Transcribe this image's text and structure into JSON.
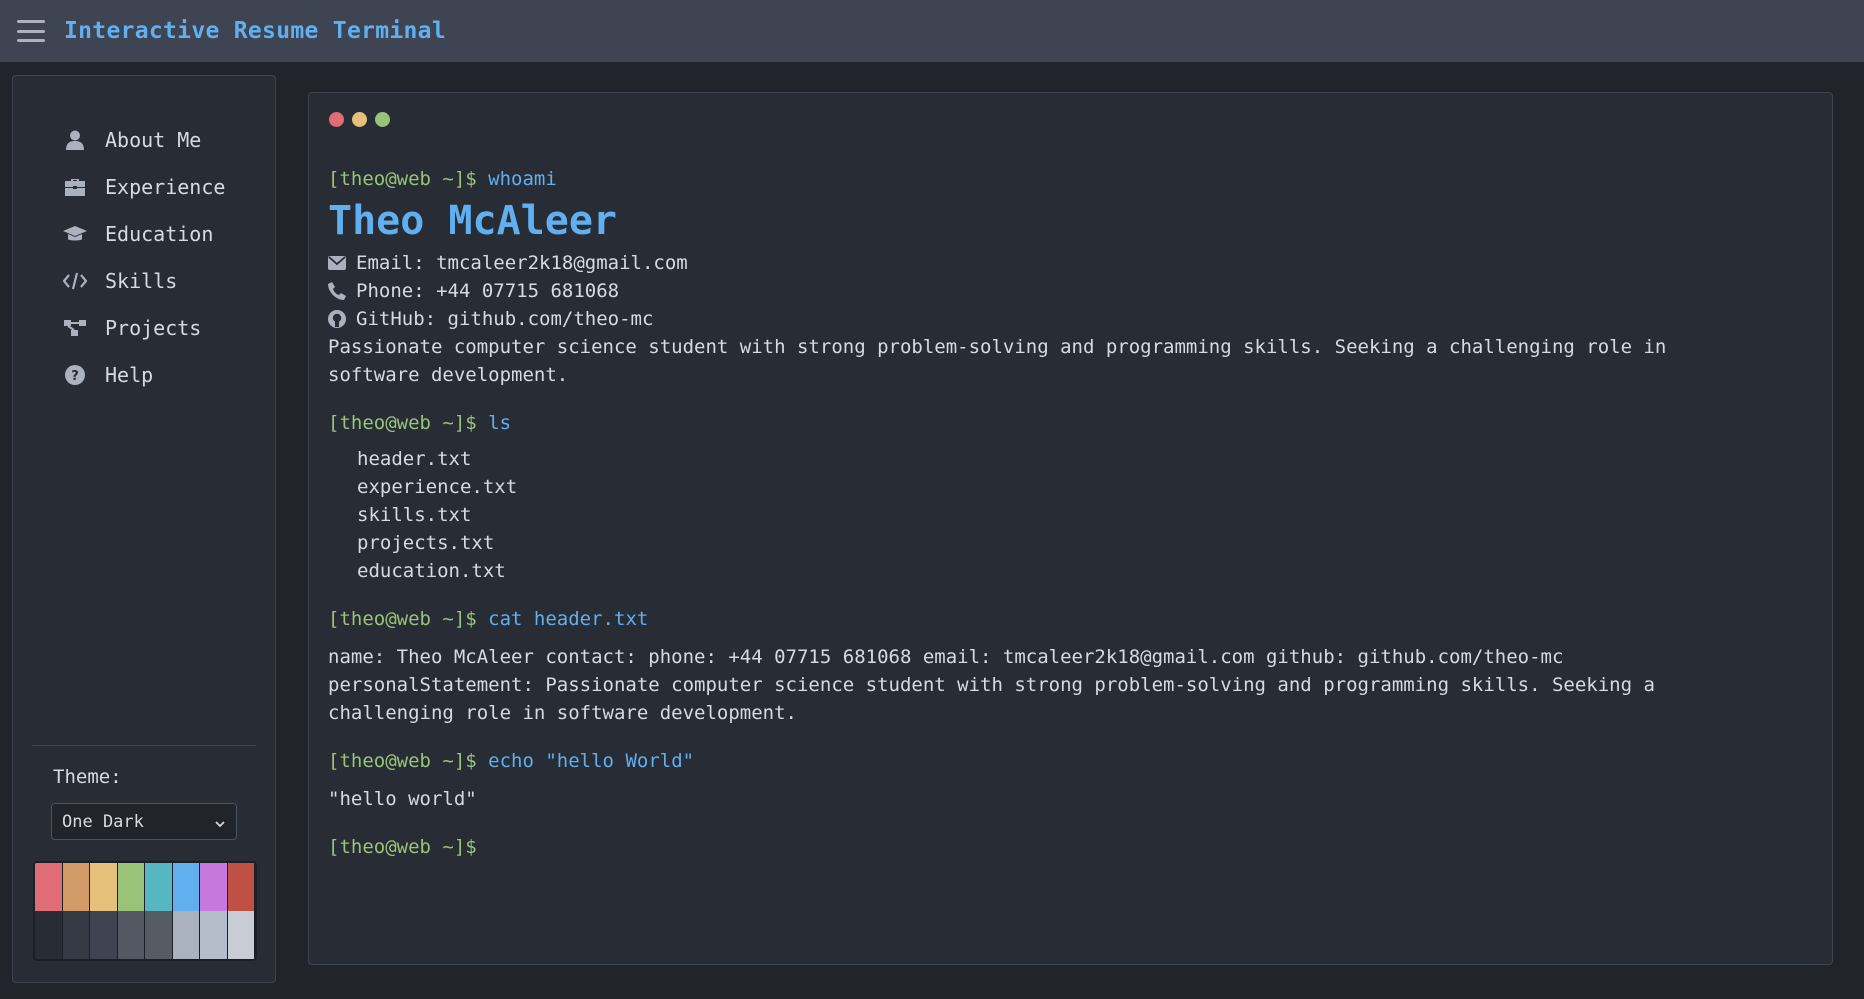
{
  "app": {
    "title": "Interactive Resume Terminal"
  },
  "sidebar": {
    "items": [
      {
        "label": "About Me",
        "icon": "user-icon"
      },
      {
        "label": "Experience",
        "icon": "briefcase-icon"
      },
      {
        "label": "Education",
        "icon": "graduation-cap-icon"
      },
      {
        "label": "Skills",
        "icon": "code-icon"
      },
      {
        "label": "Projects",
        "icon": "project-diagram-icon"
      },
      {
        "label": "Help",
        "icon": "question-circle-icon"
      }
    ],
    "theme_label": "Theme:",
    "theme_value": "One Dark",
    "palette": {
      "top": [
        "#e06c75",
        "#d19a66",
        "#e5c07b",
        "#98c379",
        "#56b6c2",
        "#61afef",
        "#c678dd",
        "#be5046"
      ],
      "bottom": [
        "#282c34",
        "#353b45",
        "#3e4451",
        "#545862",
        "#565c64",
        "#abb2bf",
        "#b6bdca",
        "#c8ccd4"
      ]
    }
  },
  "terminal": {
    "dots": [
      "#e06c75",
      "#e5c07b",
      "#98c379"
    ],
    "prompt": "[theo@web ~]$",
    "cmd_whoami": "whoami",
    "name": "Theo McAleer",
    "email": "Email: tmcaleer2k18@gmail.com",
    "phone": "Phone: +44 07715 681068",
    "github": "GitHub: github.com/theo-mc",
    "statement": "Passionate computer science student with strong problem-solving and programming skills. Seeking a challenging role in software development.",
    "cmd_ls": "ls",
    "files": [
      "header.txt",
      "experience.txt",
      "skills.txt",
      "projects.txt",
      "education.txt"
    ],
    "cmd_cat": "cat header.txt",
    "cat_output": "name: Theo McAleer contact: phone: +44 07715 681068 email: tmcaleer2k18@gmail.com github: github.com/theo-mc personalStatement: Passionate computer science student with strong problem-solving and programming skills. Seeking a challenging role in software development.",
    "cmd_echo": "echo \"hello World\"",
    "echo_output": "\"hello world\""
  }
}
